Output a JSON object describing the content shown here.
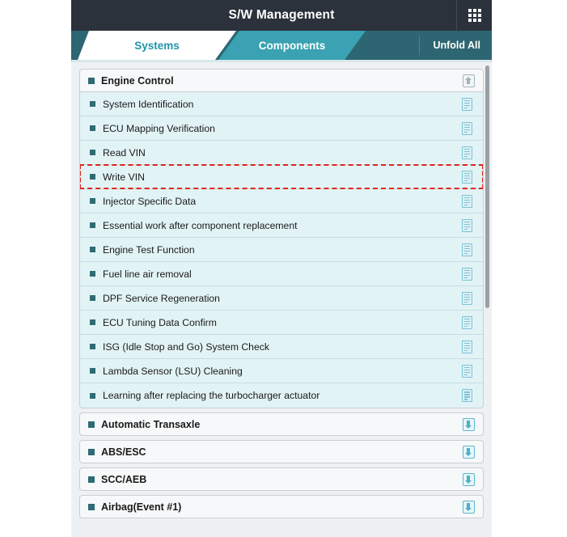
{
  "titlebar": {
    "title": "S/W Management",
    "grid_icon": "grid-menu-icon"
  },
  "tabs": [
    {
      "label": "Systems",
      "active": true
    },
    {
      "label": "Components",
      "active": false
    }
  ],
  "actions": {
    "unfold_all": "Unfold All"
  },
  "colors": {
    "titlebar_bg": "#2b323c",
    "tabbar_bg": "#2d6672",
    "active_tab_text": "#2196a8",
    "inactive_tab_bg": "#3aa2b2",
    "item_bg": "#e2f3f6",
    "bullet": "#2e6b74",
    "highlight_border": "#e2241a",
    "doc_icon": "#7cc3d4",
    "expand_icon": "#4fb0c8",
    "collapse_icon": "#9fb5bc"
  },
  "groups": [
    {
      "label": "Engine Control",
      "expanded": true,
      "toggle_icon": "collapse-up-arrow-icon",
      "items": [
        {
          "label": "System Identification",
          "icon": "document-icon",
          "highlighted": false
        },
        {
          "label": "ECU Mapping Verification",
          "icon": "document-icon",
          "highlighted": false
        },
        {
          "label": "Read VIN",
          "icon": "document-icon",
          "highlighted": false
        },
        {
          "label": "Write VIN",
          "icon": "document-icon",
          "highlighted": true
        },
        {
          "label": "Injector Specific Data",
          "icon": "document-icon",
          "highlighted": false
        },
        {
          "label": "Essential work after component replacement",
          "icon": "document-icon",
          "highlighted": false
        },
        {
          "label": "Engine Test Function",
          "icon": "document-icon",
          "highlighted": false
        },
        {
          "label": "Fuel line air removal",
          "icon": "document-icon",
          "highlighted": false
        },
        {
          "label": "DPF Service Regeneration",
          "icon": "document-icon",
          "highlighted": false
        },
        {
          "label": "ECU Tuning Data Confirm",
          "icon": "document-icon",
          "highlighted": false
        },
        {
          "label": "ISG (Idle Stop and Go) System Check",
          "icon": "document-icon",
          "highlighted": false
        },
        {
          "label": "Lambda Sensor (LSU) Cleaning",
          "icon": "document-icon",
          "highlighted": false
        },
        {
          "label": "Learning after replacing the turbocharger actuator",
          "icon": "document-icon",
          "highlighted": false
        }
      ]
    },
    {
      "label": "Automatic Transaxle",
      "expanded": false,
      "toggle_icon": "expand-down-arrow-icon",
      "items": []
    },
    {
      "label": "ABS/ESC",
      "expanded": false,
      "toggle_icon": "expand-down-arrow-icon",
      "items": []
    },
    {
      "label": "SCC/AEB",
      "expanded": false,
      "toggle_icon": "expand-down-arrow-icon",
      "items": []
    },
    {
      "label": "Airbag(Event #1)",
      "expanded": false,
      "toggle_icon": "expand-down-arrow-icon",
      "items": []
    }
  ]
}
